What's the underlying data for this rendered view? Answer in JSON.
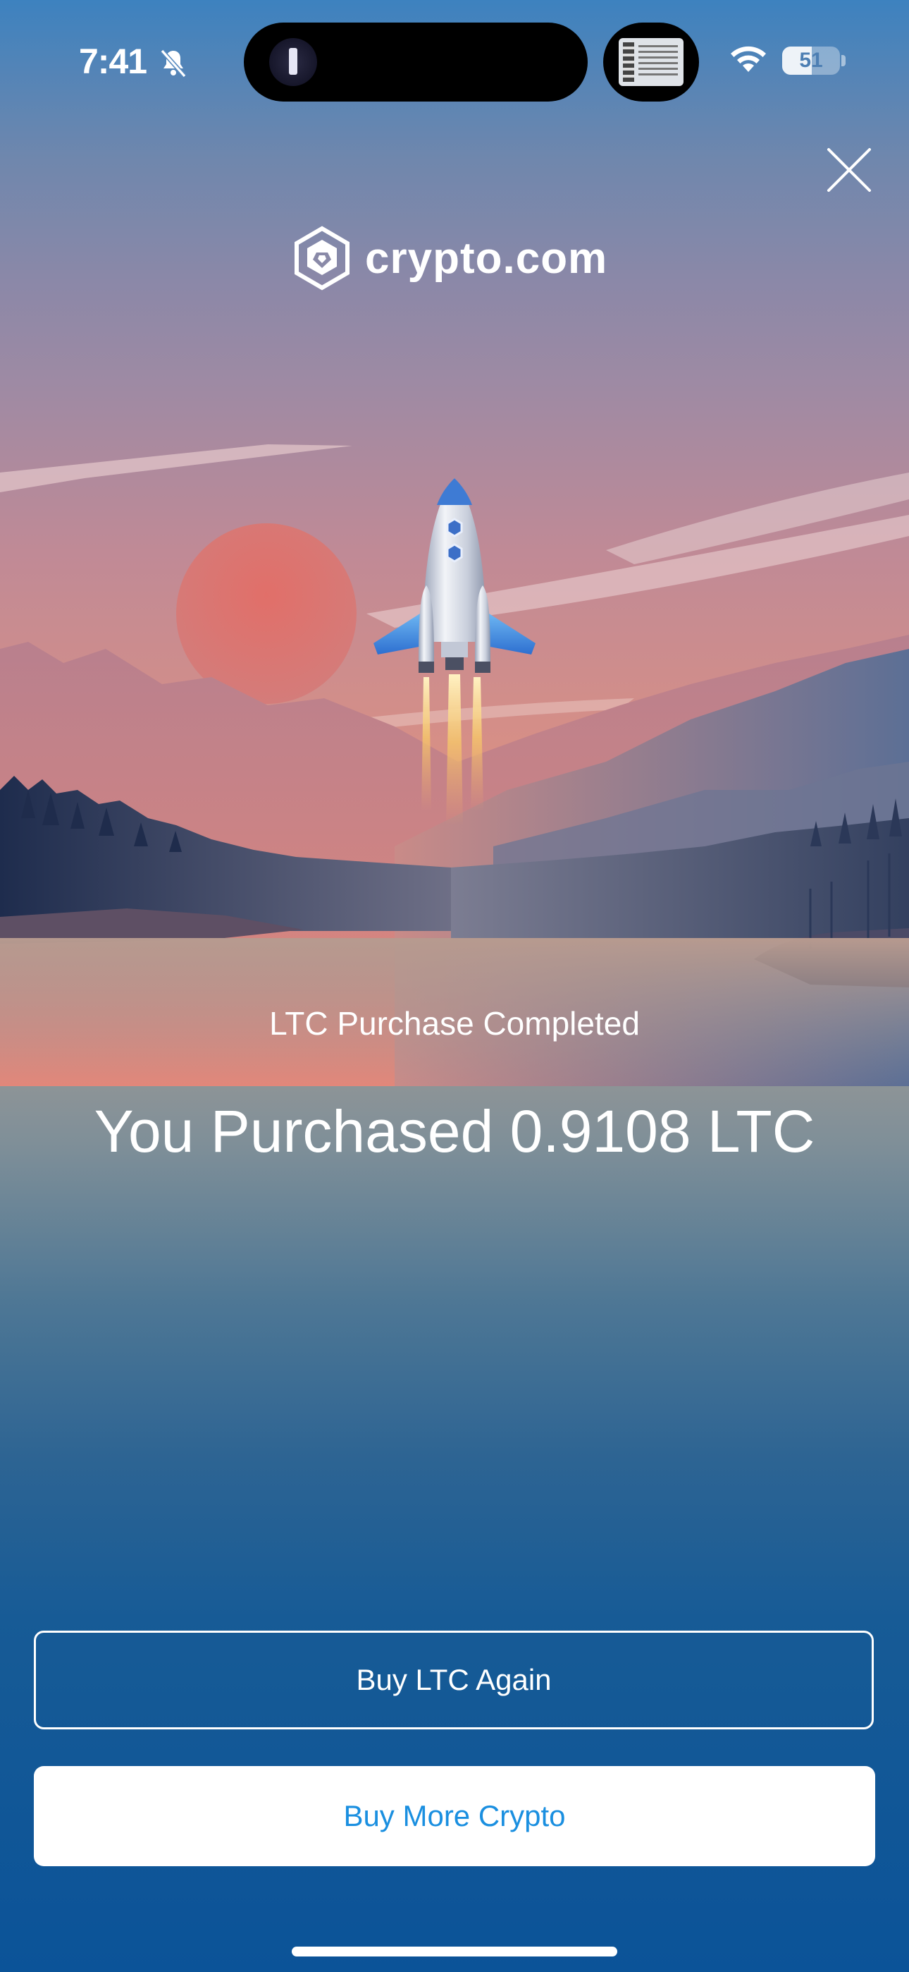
{
  "status_bar": {
    "time": "7:41",
    "battery_level": "51",
    "battery_fraction": 0.51
  },
  "icons": {
    "close": "close-icon",
    "bell_off": "bell-off-icon",
    "wifi": "wifi-icon",
    "battery": "battery-icon",
    "flashlight": "flashlight-icon",
    "logo": "crypto-com-logo-icon",
    "rocket": "rocket-illustration"
  },
  "brand": {
    "name": "crypto.com"
  },
  "result": {
    "subtitle": "LTC Purchase Completed",
    "headline": "You Purchased 0.9108 LTC"
  },
  "actions": {
    "primary_label": "Buy LTC Again",
    "secondary_label": "Buy More Crypto"
  },
  "colors": {
    "button_text_accent": "#1a8fe0",
    "background_bottom": "#0b5398"
  }
}
